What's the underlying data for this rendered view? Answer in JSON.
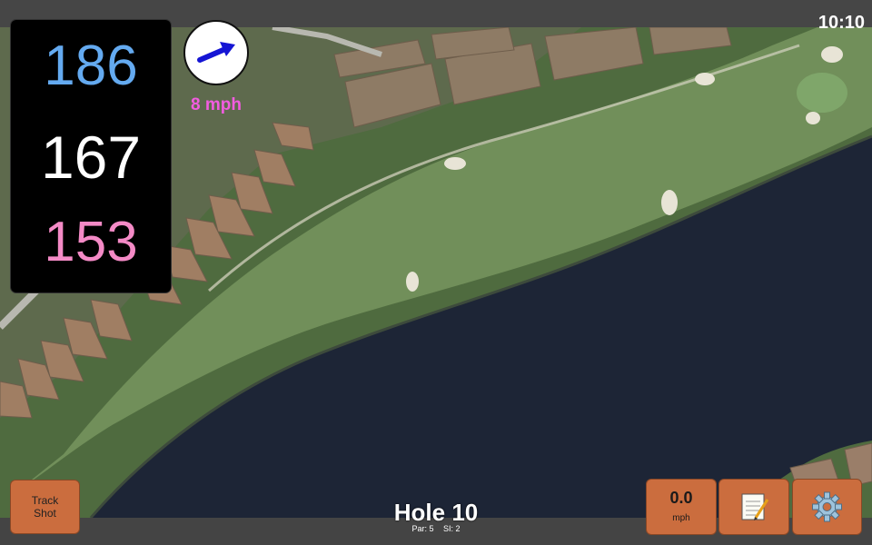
{
  "status": {
    "time": "10:10"
  },
  "distances": {
    "back": "186",
    "middle": "167",
    "front": "153"
  },
  "wind": {
    "speed_label": "8 mph",
    "arrow_icon": "wind-arrow-icon"
  },
  "hole": {
    "title": "Hole 10",
    "par_label": "Par: 5",
    "si_label": "SI: 2"
  },
  "buttons": {
    "track_shot": "Track Shot",
    "speed_value": "0.0",
    "speed_unit": "mph",
    "notes_icon": "notepad-icon",
    "settings_icon": "gear-icon"
  },
  "colors": {
    "back": "#64aaf0",
    "middle": "#ffffff",
    "front": "#f48ac6",
    "wind_speed": "#f25ce0",
    "button": "#cb6d3e",
    "water": "#1c2335",
    "fairway": "#6f9559"
  }
}
